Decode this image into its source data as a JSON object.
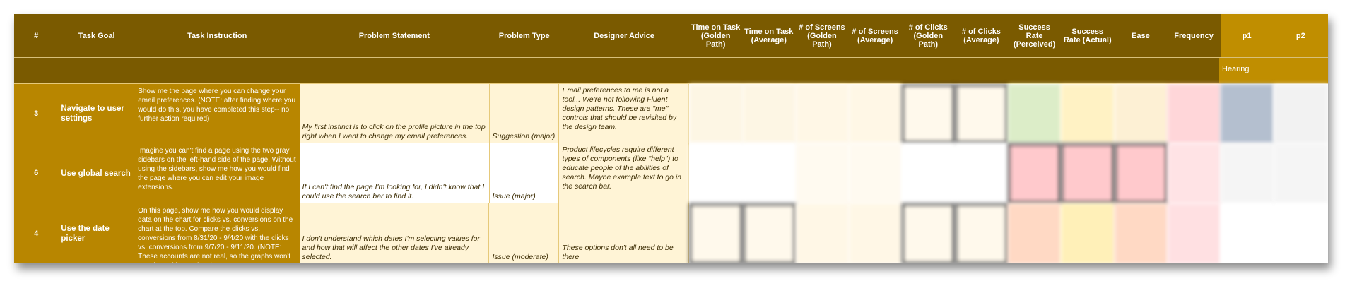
{
  "header": {
    "num": "#",
    "task_goal": "Task Goal",
    "task_instruction": "Task Instruction",
    "problem_statement": "Problem Statement",
    "problem_type": "Problem Type",
    "designer_advice": "Designer Advice",
    "time_golden": "Time on Task (Golden Path)",
    "time_average": "Time on Task (Average)",
    "screens_golden": "# of Screens (Golden Path)",
    "screens_average": "# of Screens (Average)",
    "clicks_golden": "# of Clicks (Golden Path)",
    "clicks_average": "# of Clicks (Average)",
    "success_perceived": "Success Rate (Perceived)",
    "success_actual": "Success Rate (Actual)",
    "ease": "Ease",
    "frequency": "Frequency",
    "p1": "p1",
    "p2": "p2"
  },
  "band": {
    "p1_label": "Hearing"
  },
  "rows": [
    {
      "num": "3",
      "goal": "Navigate to user settings",
      "instruction": "Show me the page where you can change your email preferences. (NOTE: after finding where you would do this, you have completed this step-- no further action required)",
      "problem": "My first instinct is to click on the profile picture in the top right when I want to change my email preferences.",
      "type": "Suggestion (major)",
      "advice": "Email preferences to me is not a tool... We're not following Fluent design patterns. These are \"me\" controls that should be revisited by the design team."
    },
    {
      "num": "6",
      "goal": "Use global search",
      "instruction": "Imagine you can't find a page using the two gray sidebars on the left-hand side of the page. Without using the sidebars, show me how you would find the page where you can edit your image extensions.",
      "problem": "If I can't find the page I'm looking for, I didn't know that I could use the search bar to find it.",
      "type": "Issue (major)",
      "advice": "Product lifecycles require different types of components (like \"help\") to educate people of the abilities of search. Maybe example text to go in the search bar."
    },
    {
      "num": "4",
      "goal": "Use the date picker",
      "instruction": "On this page, show me how you would display data on the chart for clicks vs. conversions on the chart at the top. Compare the clicks vs. conversions from 8/31/20 - 9/4/20 with the clicks vs. conversions from 9/7/20 - 9/11/20. (NOTE: These accounts are not real, so the graphs won't populate with any data.)",
      "problem": "I don't understand which dates I'm selecting values for and how that will affect the other dates I've already selected.",
      "type": "Issue (moderate)",
      "advice": "These options don't all need to be there"
    }
  ],
  "colors": {
    "header_bg": "#7a5a00",
    "goal_bg": "#b88600",
    "p_col_bg": "#c08e00",
    "note_bg": "#fff4d6"
  }
}
